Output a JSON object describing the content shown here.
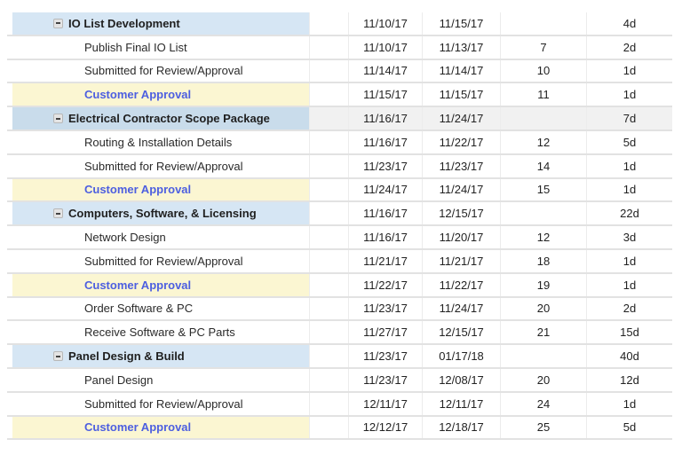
{
  "rows": [
    {
      "type": "group",
      "name": "IO List Development",
      "start": "11/10/17",
      "end": "11/15/17",
      "predecessors": "",
      "duration": "4d"
    },
    {
      "type": "task",
      "name": "Publish Final IO List",
      "start": "11/10/17",
      "end": "11/13/17",
      "predecessors": "7",
      "duration": "2d"
    },
    {
      "type": "task",
      "name": "Submitted for Review/Approval",
      "start": "11/14/17",
      "end": "11/14/17",
      "predecessors": "10",
      "duration": "1d"
    },
    {
      "type": "milestone",
      "name": "Customer Approval",
      "start": "11/15/17",
      "end": "11/15/17",
      "predecessors": "11",
      "duration": "1d"
    },
    {
      "type": "group",
      "selected": true,
      "name": "Electrical Contractor Scope Package",
      "start": "11/16/17",
      "end": "11/24/17",
      "predecessors": "",
      "duration": "7d"
    },
    {
      "type": "task",
      "name": "Routing & Installation Details",
      "start": "11/16/17",
      "end": "11/22/17",
      "predecessors": "12",
      "duration": "5d"
    },
    {
      "type": "task",
      "name": "Submitted for Review/Approval",
      "start": "11/23/17",
      "end": "11/23/17",
      "predecessors": "14",
      "duration": "1d"
    },
    {
      "type": "milestone",
      "name": "Customer Approval",
      "start": "11/24/17",
      "end": "11/24/17",
      "predecessors": "15",
      "duration": "1d"
    },
    {
      "type": "group",
      "name": "Computers, Software, & Licensing",
      "start": "11/16/17",
      "end": "12/15/17",
      "predecessors": "",
      "duration": "22d"
    },
    {
      "type": "task",
      "name": "Network Design",
      "start": "11/16/17",
      "end": "11/20/17",
      "predecessors": "12",
      "duration": "3d"
    },
    {
      "type": "task",
      "name": "Submitted for Review/Approval",
      "start": "11/21/17",
      "end": "11/21/17",
      "predecessors": "18",
      "duration": "1d"
    },
    {
      "type": "milestone",
      "name": "Customer Approval",
      "start": "11/22/17",
      "end": "11/22/17",
      "predecessors": "19",
      "duration": "1d"
    },
    {
      "type": "task",
      "name": "Order Software & PC",
      "start": "11/23/17",
      "end": "11/24/17",
      "predecessors": "20",
      "duration": "2d"
    },
    {
      "type": "task",
      "name": "Receive Software & PC Parts",
      "start": "11/27/17",
      "end": "12/15/17",
      "predecessors": "21",
      "duration": "15d"
    },
    {
      "type": "group",
      "name": "Panel Design & Build",
      "start": "11/23/17",
      "end": "01/17/18",
      "predecessors": "",
      "duration": "40d"
    },
    {
      "type": "task",
      "name": "Panel Design",
      "start": "11/23/17",
      "end": "12/08/17",
      "predecessors": "20",
      "duration": "12d"
    },
    {
      "type": "task",
      "name": "Submitted for Review/Approval",
      "start": "12/11/17",
      "end": "12/11/17",
      "predecessors": "24",
      "duration": "1d"
    },
    {
      "type": "milestone",
      "name": "Customer Approval",
      "start": "12/12/17",
      "end": "12/18/17",
      "predecessors": "25",
      "duration": "5d"
    }
  ],
  "colors": {
    "group_bg": "#d6e6f4",
    "selected_group_bg": "#c9dceb",
    "milestone_bg": "#fbf6d2",
    "milestone_text": "#4d5fe0"
  },
  "icons": {
    "group_toggle": "collapse-minus-icon"
  }
}
